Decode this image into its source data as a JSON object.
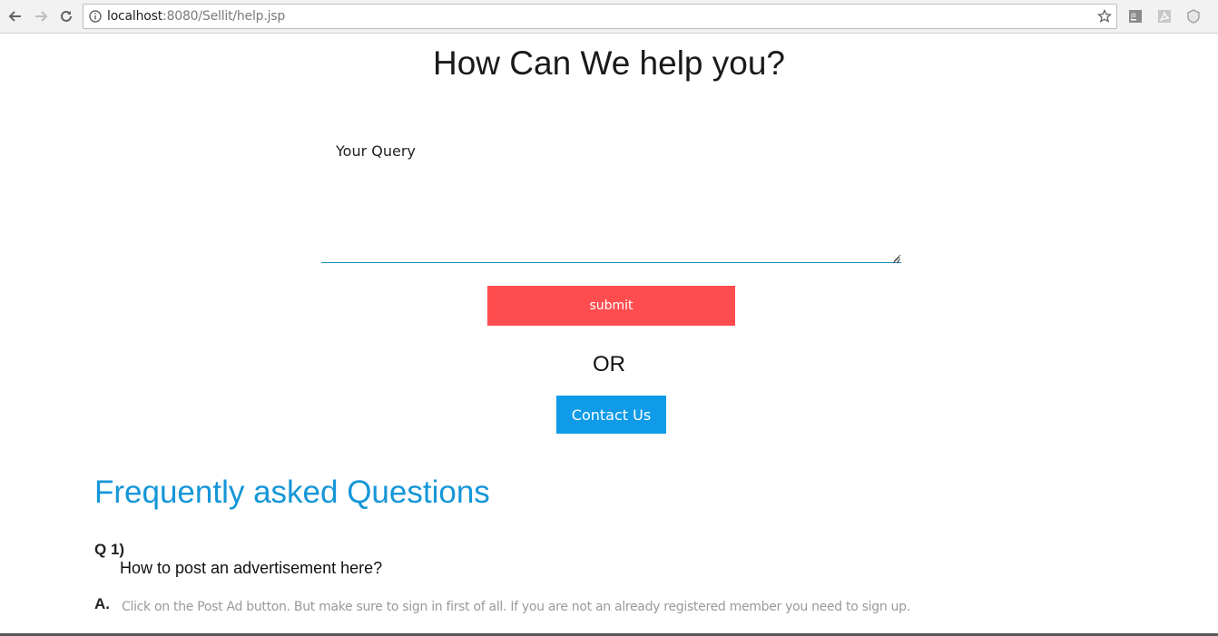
{
  "browser": {
    "url_host": "localhost",
    "url_rest": ":8080/Sellit/help.jsp",
    "icons": {
      "back": "back-arrow-icon",
      "forward": "forward-arrow-icon",
      "reload": "reload-icon",
      "info": "info-icon",
      "bookmark": "star-icon",
      "ext1": "jb-extension-icon",
      "ext2": "pdf-extension-icon",
      "ext3": "shield-extension-icon"
    }
  },
  "page": {
    "title": "How Can We help you?",
    "query_placeholder": "Your Query",
    "submit_label": "submit",
    "or_text": "OR",
    "contact_label": "Contact Us"
  },
  "faq": {
    "heading": "Frequently asked Questions",
    "items": [
      {
        "q_label": "Q 1)",
        "question": "How to post an advertisement here?",
        "a_label": "A.",
        "answer": "Click on the Post Ad button. But make sure to sign in first of all. If you are not an already registered member you need to sign up."
      }
    ]
  },
  "colors": {
    "submit_bg": "#ff4d4f",
    "contact_bg": "#0f9be8",
    "faq_heading": "#1596d8",
    "answer_text": "#9a9a9a"
  }
}
